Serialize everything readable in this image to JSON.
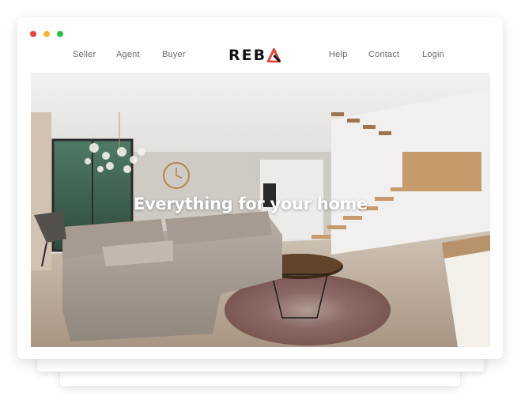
{
  "nav": {
    "left_links": [
      "Seller",
      "Agent",
      "Buyer"
    ],
    "right_links": [
      "Help",
      "Contact",
      "Login"
    ],
    "logo_text": "REB"
  },
  "hero": {
    "headline": "Everything for your home",
    "image_description_icon": "living-room-photo"
  },
  "colors": {
    "dot_red": "#e8453c",
    "dot_yellow": "#f5b82e",
    "dot_green": "#2bbf4a",
    "logo_accent": "#e8453c",
    "logo_dark": "#111418"
  }
}
